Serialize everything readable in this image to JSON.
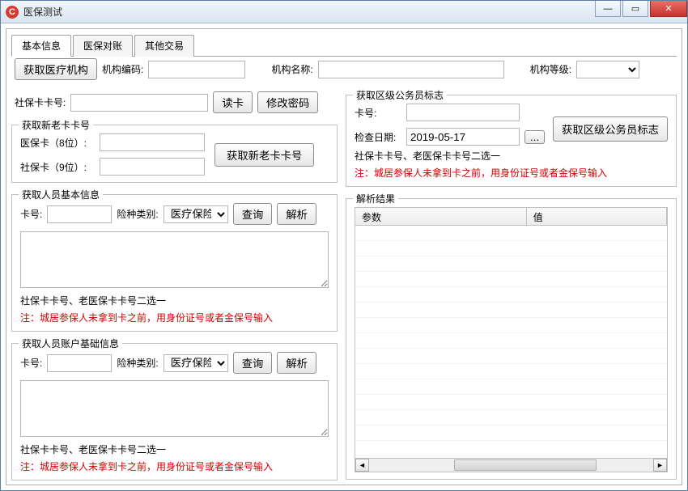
{
  "window": {
    "title": "医保测试"
  },
  "tabs": [
    {
      "label": "基本信息",
      "active": true
    },
    {
      "label": "医保对账",
      "active": false
    },
    {
      "label": "其他交易",
      "active": false
    }
  ],
  "toolbar": {
    "fetch_org_btn": "获取医疗机构",
    "org_code_label": "机构编码:",
    "org_name_label": "机构名称:",
    "org_level_label": "机构等级:"
  },
  "card_read": {
    "label": "社保卡卡号:",
    "read_btn": "读卡",
    "change_pwd_btn": "修改密码"
  },
  "group_newold": {
    "legend": "获取新老卡卡号",
    "med_card_label": "医保卡（8位）:",
    "soc_card_label": "社保卡（9位）:",
    "fetch_btn": "获取新老卡卡号"
  },
  "group_basic": {
    "legend": "获取人员基本信息",
    "card_label": "卡号:",
    "ins_type_label": "险种类别:",
    "ins_type_value": "医疗保险",
    "query_btn": "查询",
    "parse_btn": "解析",
    "note1": "社保卡卡号、老医保卡卡号二选一",
    "note2": "注：城居参保人未拿到卡之前，用身份证号或者金保号输入"
  },
  "group_account": {
    "legend": "获取人员账户基础信息",
    "card_label": "卡号:",
    "ins_type_label": "险种类别:",
    "ins_type_value": "医疗保险",
    "query_btn": "查询",
    "parse_btn": "解析",
    "note1": "社保卡卡号、老医保卡卡号二选一",
    "note2": "注：城居参保人未拿到卡之前，用身份证号或者金保号输入"
  },
  "group_civil": {
    "legend": "获取区级公务员标志",
    "card_label": "卡号:",
    "check_date_label": "检查日期:",
    "check_date_value": "2019-05-17",
    "datepick_btn": "...",
    "fetch_btn": "获取区级公务员标志",
    "note1": "社保卡卡号、老医保卡卡号二选一",
    "note2": "注：城居参保人未拿到卡之前，用身份证号或者金保号输入"
  },
  "parse_result": {
    "legend": "解析结果",
    "col_param": "参数",
    "col_value": "值"
  }
}
